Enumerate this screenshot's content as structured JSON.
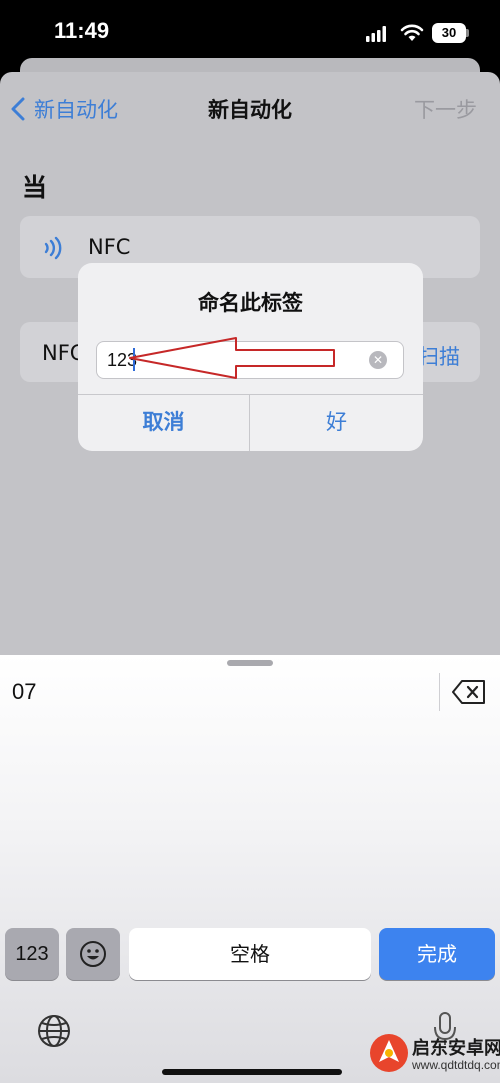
{
  "status_bar": {
    "time": "11:49",
    "battery": "30"
  },
  "nav": {
    "back_label": "新自动化",
    "title": "新自动化",
    "next_label": "下一步"
  },
  "section": {
    "heading": "当"
  },
  "trigger": {
    "label": "NFC"
  },
  "tag_row": {
    "label": "NFC",
    "scan_label": "扫描"
  },
  "alert": {
    "title": "命名此标签",
    "input_value": "123",
    "cancel_label": "取消",
    "ok_label": "好"
  },
  "keyboard": {
    "candidate": "07",
    "key_123": "123",
    "space_label": "空格",
    "done_label": "完成"
  },
  "watermark": {
    "name": "启东安卓网",
    "url": "www.qdtdtdq.com"
  },
  "colors": {
    "accent": "#3d7ed6",
    "done_key": "#3d83ef",
    "arrow": "#c62828"
  },
  "icons": [
    "chevron-left-icon",
    "nfc-icon",
    "clear-icon",
    "backspace-icon",
    "emoji-icon",
    "globe-icon",
    "microphone-icon",
    "arrow-annotation"
  ]
}
